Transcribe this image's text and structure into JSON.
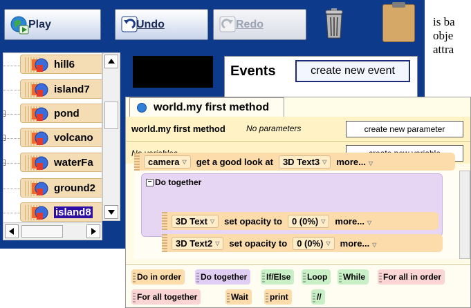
{
  "doc_text": [
    "is ba",
    "obje",
    "attra"
  ],
  "toolbar": {
    "play_label": "Play",
    "undo_label": "Undo",
    "redo_label": "Redo",
    "trash_icon": "trash-can-icon",
    "clipboard_icon": "clipboard-icon"
  },
  "tree": {
    "items": [
      {
        "label": "hill6",
        "selected": false,
        "expandable": false
      },
      {
        "label": "island7",
        "selected": false,
        "expandable": false
      },
      {
        "label": "pond",
        "selected": false,
        "expandable": true
      },
      {
        "label": "volcano",
        "selected": false,
        "expandable": true
      },
      {
        "label": "waterFa",
        "selected": false,
        "expandable": true
      },
      {
        "label": "ground2",
        "selected": false,
        "expandable": false
      },
      {
        "label": "island8",
        "selected": true,
        "expandable": false
      }
    ]
  },
  "events": {
    "title": "Events",
    "create_button": "create new event"
  },
  "editor": {
    "tab_label": "world.my first method",
    "method_name": "world.my first method",
    "params_note": "No parameters",
    "create_param_button": "create new parameter",
    "vars_note": "No variables",
    "create_var_button": "create new variable",
    "code": {
      "camera_stmt": {
        "object": "camera",
        "action": "get a good look at",
        "target": "3D Text3",
        "more": "more..."
      },
      "do_together_label": "Do together",
      "ops": [
        {
          "object": "3D Text",
          "action": "set opacity to",
          "value": "0 (0%)",
          "more": "more..."
        },
        {
          "object": "3D Text2",
          "action": "set opacity to",
          "value": "0 (0%)",
          "more": "more..."
        }
      ]
    },
    "palette": {
      "do_in_order": "Do in order",
      "do_together": "Do together",
      "if_else": "If/Else",
      "loop": "Loop",
      "while": "While",
      "for_all_in_order": "For all in order",
      "for_all_together": "For all together",
      "wait": "Wait",
      "print": "print",
      "comment": "//"
    }
  },
  "colors": {
    "app_background": "#0e3a8c",
    "selected_item": "#2e0fa6",
    "statement_fill": "#fbdcaa",
    "do_together_fill": "#e6d5f3"
  }
}
